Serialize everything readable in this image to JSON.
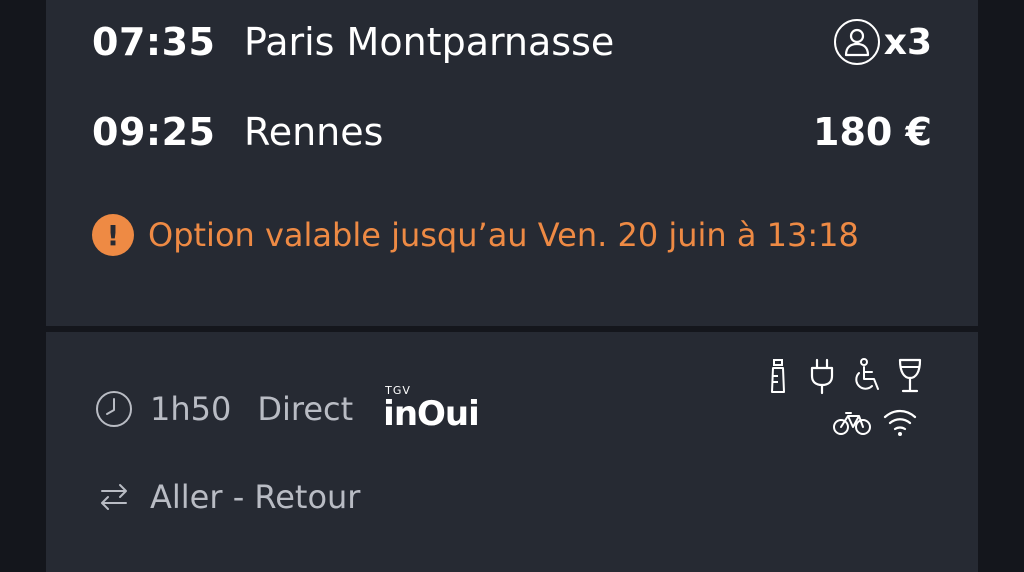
{
  "journey": {
    "departure": {
      "time": "07:35",
      "station": "Paris Montparnasse"
    },
    "arrival": {
      "time": "09:25",
      "station": "Rennes"
    },
    "passengers": {
      "icon": "person-icon",
      "count": "x3"
    },
    "price": "180 €",
    "alert": {
      "icon": "exclamation-icon",
      "text": "Option valable jusqu’au Ven. 20 juin à 13:18",
      "color": "#ee8a44"
    }
  },
  "details": {
    "duration": "1h50",
    "connection": "Direct",
    "brand": {
      "top": "TGV",
      "name": "inOui"
    },
    "amenities": [
      "baby-bottle-icon",
      "power-plug-icon",
      "wheelchair-icon",
      "bar-glass-icon",
      "bicycle-icon",
      "wifi-icon"
    ],
    "trip_type": "Aller - Retour"
  },
  "colors": {
    "background": "#14161c",
    "card": "#262a33",
    "text": "#ffffff",
    "muted": "#b9bcc4",
    "accent": "#ee8a44"
  }
}
